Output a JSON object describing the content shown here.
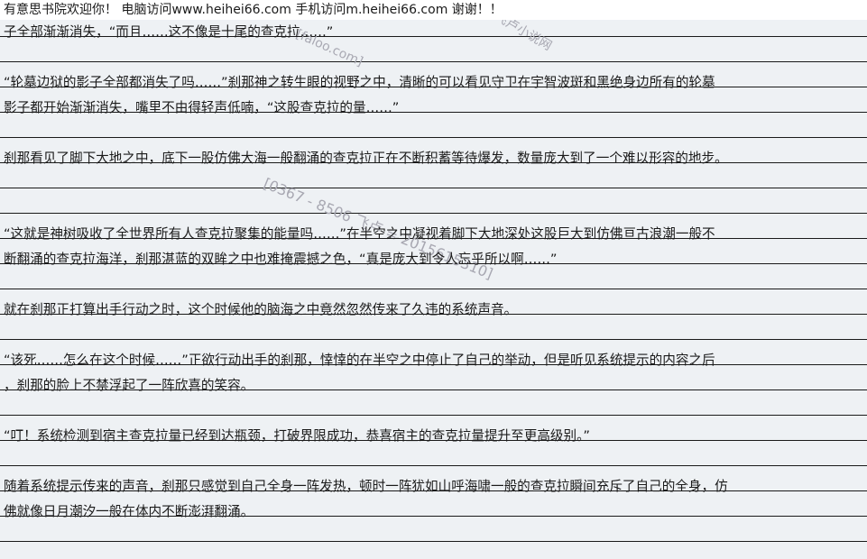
{
  "banner": {
    "text": "有意思书院欢迎你！  电脑访问www.heihei66.com    手机访问m.heihei66.com  谢谢！！"
  },
  "lines": [
    "子全部渐渐消失，“而且……这不像是十尾的查克拉……”",
    "",
    "        “轮墓边狱的影子全部都消失了吗……”刹那神之转生眼的视野之中，清晰的可以看见守卫在宇智波斑和黑绝身边所有的轮墓",
    "影子都开始渐渐消失，嘴里不由得轻声低喃，“这股查克拉的量……”",
    "",
    "        刹那看见了脚下大地之中，底下一股仿佛大海一般翻涌的查克拉正在不断积蓄等待爆发，数量庞大到了一个难以形容的地步。",
    "",
    "",
    "        “这就是神树吸收了全世界所有人查克拉聚集的能量吗……”在半空之中凝视着脚下大地深处这股巨大到仿佛亘古浪潮一般不",
    "断翻涌的查克拉海洋，刹那湛蓝的双眸之中也难掩震撼之色，“真是庞大到令人忘乎所以啊……”",
    "",
    "        就在刹那正打算出手行动之时，这个时候他的脑海之中竟然忽然传来了久违的系统声音。",
    "",
    "        “该死……怎么在这个时候……”正欲行动出手的刹那，悻悻的在半空之中停止了自己的举动，但是听见系统提示的内容之后",
    "，刹那的脸上不禁浮起了一阵欣喜的笑容。",
    "",
    "        “叮！系统检测到宿主查克拉量已经到达瓶颈，打破界限成功，恭喜宿主的查克拉量提升至更高级别。”",
    "",
    "        随着系统提示传来的声音，刹那只感觉到自己全身一阵发热，顿时一阵犹如山呼海啸一般的查克拉瞬间充斥了自己的全身，仿",
    "佛就像日月潮汐一般在体内不断澎湃翻涌。"
  ],
  "watermarks": {
    "main": "[0367 - 8506 飞卢 = 2015615310]",
    "small": "[faloo.com]",
    "corner": "飞卢小说网"
  }
}
